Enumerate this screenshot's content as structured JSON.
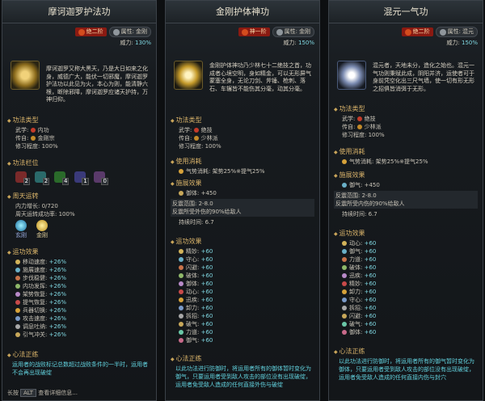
{
  "panels": [
    {
      "title": "摩诃迦罗护法功",
      "rank": "绝二阶",
      "attr_label": "属性:",
      "attr": "金刚",
      "power_label": "威力:",
      "power": "130%",
      "desc": "摩诃迦罗又称大黑天，乃是大日如来之化身，威德广大，能伏一切邪魔，摩诃迦罗护法功以此见为火，本心为则，能清静六根，断除邪障，摩诃迦罗应诸天护持，万神归仰。",
      "type_title": "功法类型",
      "wuxue_label": "武学:",
      "wuxue": "内功",
      "chuanzi_label": "传自:",
      "chuanzi": "金刚宗",
      "difficulty_label": "修习程度:",
      "difficulty": "100%",
      "slots_title": "功法栏位",
      "slots": [
        "2",
        "2",
        "4",
        "1",
        "0"
      ],
      "zhoutian_title": "周天运转",
      "neili_label": "内力增长:",
      "neili": "0/720",
      "success_label": "周天运转成功率:",
      "success": "100%",
      "gem_names": [
        "玄刚",
        "金刚"
      ],
      "effects_title": "运功效果",
      "effects": [
        {
          "name": "移动速度",
          "val": "+26%"
        },
        {
          "name": "施展速度",
          "val": "+26%"
        },
        {
          "name": "步伐稳健",
          "val": "+26%"
        },
        {
          "name": "内功发挥",
          "val": "+26%"
        },
        {
          "name": "架势恢复",
          "val": "+26%"
        },
        {
          "name": "提气恢复",
          "val": "+26%"
        },
        {
          "name": "兵器切换",
          "val": "+26%"
        },
        {
          "name": "攻击速度",
          "val": "+26%"
        },
        {
          "name": "调息吐纳",
          "val": "+26%"
        },
        {
          "name": "引气冲关",
          "val": "+26%"
        }
      ],
      "xinfa_title": "心法正练",
      "xinfa": "运用者的战败标记总数超过战败条件的一半时，运用者不会再出现破绽"
    },
    {
      "title": "金刚护体神功",
      "rank": "神一阶",
      "attr_label": "属性:",
      "attr": "金刚",
      "power_label": "威力:",
      "power": "150%",
      "desc": "金刚护体神功乃少林七十二绝技之首，功成者心境空明，身如精金，可以无形屏气蒙塞全身，无论刀剑、斧锤、枪刺、落石、车辗皆不能伤其分毫，动其分毫。",
      "type_title": "功法类型",
      "wuxue_label": "武学:",
      "wuxue": "绝技",
      "chuanzi_label": "传自:",
      "chuanzi": "少林派",
      "difficulty_label": "修习程度:",
      "difficulty": "100%",
      "cost_title": "使用消耗",
      "cost": "气势消耗: 架势25%※提气25%",
      "cast_title": "施展效果",
      "cast_main": "御体: +450",
      "range": "反震范围: 2-8.0",
      "range_desc": "反震所受外伤的90%给敌人",
      "dur": "持续时间: 6.7",
      "effects_title": "运功效果",
      "effects": [
        {
          "name": "精妙",
          "val": "+60"
        },
        {
          "name": "守心",
          "val": "+60"
        },
        {
          "name": "闪避",
          "val": "+60"
        },
        {
          "name": "破体",
          "val": "+60"
        },
        {
          "name": "御体",
          "val": "+60"
        },
        {
          "name": "动心",
          "val": "+60"
        },
        {
          "name": "迅疾",
          "val": "+60"
        },
        {
          "name": "卸力",
          "val": "+60"
        },
        {
          "name": "拆招",
          "val": "+60"
        },
        {
          "name": "破气",
          "val": "+60"
        },
        {
          "name": "力道",
          "val": "+60"
        },
        {
          "name": "御气",
          "val": "+60"
        }
      ],
      "xinfa_title": "心法正练",
      "xinfa": "以此功法进行防御时，将运用者所有的御体暂时变化为御气，只要运用者受到敌人攻击的部位没有出现破绽，运用者免受敌人造成的任何直接外伤与破绽"
    },
    {
      "title": "混元一气功",
      "rank": "绝二阶",
      "attr_label": "属性:",
      "attr": "混元",
      "power_label": "威力:",
      "power": "150%",
      "desc": "混元者，天地未分，造化之始也。混元一气功则秉赋此成，阴阳并济，运使者可于身前凭空化出三尺气墙，使一切有形无形之招俱皆消弭于无形。",
      "type_title": "功法类型",
      "wuxue_label": "武学:",
      "wuxue": "绝技",
      "chuanzi_label": "传自:",
      "chuanzi": "少林派",
      "difficulty_label": "修习程度:",
      "difficulty": "100%",
      "cost_title": "使用消耗",
      "cost": "气势消耗: 架势25%※提气25%",
      "cast_title": "施展效果",
      "cast_main": "御气: +450",
      "range": "反震范围: 2-8.0",
      "range_desc": "反震所受内伤的90%给敌人",
      "dur": "持续时间: 6.7",
      "effects_title": "运功效果",
      "effects": [
        {
          "name": "动心",
          "val": "+60"
        },
        {
          "name": "御气",
          "val": "+60"
        },
        {
          "name": "力道",
          "val": "+60"
        },
        {
          "name": "破体",
          "val": "+60"
        },
        {
          "name": "迅疾",
          "val": "+60"
        },
        {
          "name": "精妙",
          "val": "+60"
        },
        {
          "name": "卸力",
          "val": "+60"
        },
        {
          "name": "守心",
          "val": "+60"
        },
        {
          "name": "拆招",
          "val": "+60"
        },
        {
          "name": "闪避",
          "val": "+60"
        },
        {
          "name": "破气",
          "val": "+60"
        },
        {
          "name": "御体",
          "val": "+60"
        }
      ],
      "xinfa_title": "心法正练",
      "xinfa": "以此功法进行防御时，将运用者所有的御气暂时变化为御体，只要运用者受到敌人攻击的部位没有出现破绽，运用者免受敌人造成的任何直接内伤与封穴"
    }
  ],
  "footer": {
    "hint_label": "长按",
    "key": "ALT",
    "hint_text": "查看详细信息..."
  },
  "colors": {
    "gold": "#d9b36a",
    "cyan": "#7fd6e0",
    "rank_red": "#8a1a12"
  }
}
